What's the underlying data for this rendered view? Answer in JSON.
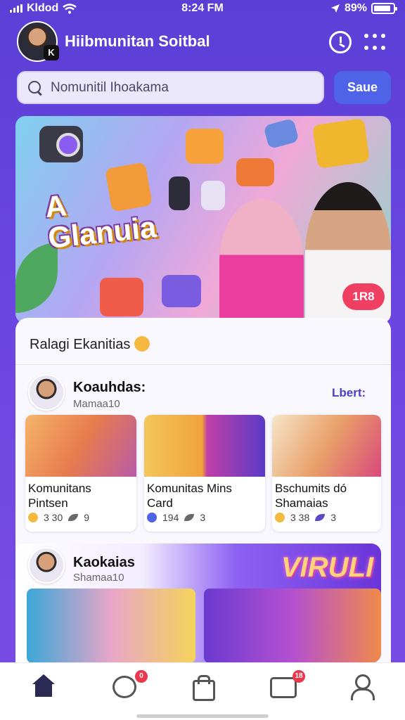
{
  "status_bar": {
    "carrier": "Kldod",
    "time": "8:24 FM",
    "battery": "89%",
    "battery_level": 0.89
  },
  "header": {
    "title": "Hiibmunitan Soitbal",
    "avatar_badge": "K",
    "icons": [
      "clock-icon",
      "more-dots-icon"
    ]
  },
  "search": {
    "placeholder": "Nomunitil Ihoakama",
    "button_label": "Saue"
  },
  "banner": {
    "title_line1": "A",
    "title_line2": "Glanuia",
    "count_badge": "1R8"
  },
  "section": {
    "heading": "Ralagi Ekanitias"
  },
  "group1": {
    "name": "Koauhdas:",
    "subtitle": "Mamaa10",
    "link": "Lbert:"
  },
  "cards": [
    {
      "title": "Komunitans\nPintsen",
      "stat1": "3 30",
      "stat2": "9",
      "stat1_color": "#f5b942"
    },
    {
      "title": "Komunitas Mins\nCard",
      "stat1": "194",
      "stat2": "3",
      "stat1_color": "#4f63e8"
    },
    {
      "title": "Bschumits dó\nShamaias",
      "stat1": "3 38",
      "stat2": "3",
      "stat1_color": "#f5b942"
    }
  ],
  "group2": {
    "name": "Kaokaias",
    "subtitle": "Shamaa10",
    "banner_text": "VIRULI"
  },
  "bottom_nav": {
    "items": [
      "home-icon",
      "chat-icon",
      "bag-icon",
      "message-icon",
      "user-icon"
    ],
    "chat_badge": "0",
    "message_badge": "18"
  },
  "colors": {
    "background": "#5a3fd6",
    "accent": "#4f63e8",
    "badge": "#ef4063"
  }
}
